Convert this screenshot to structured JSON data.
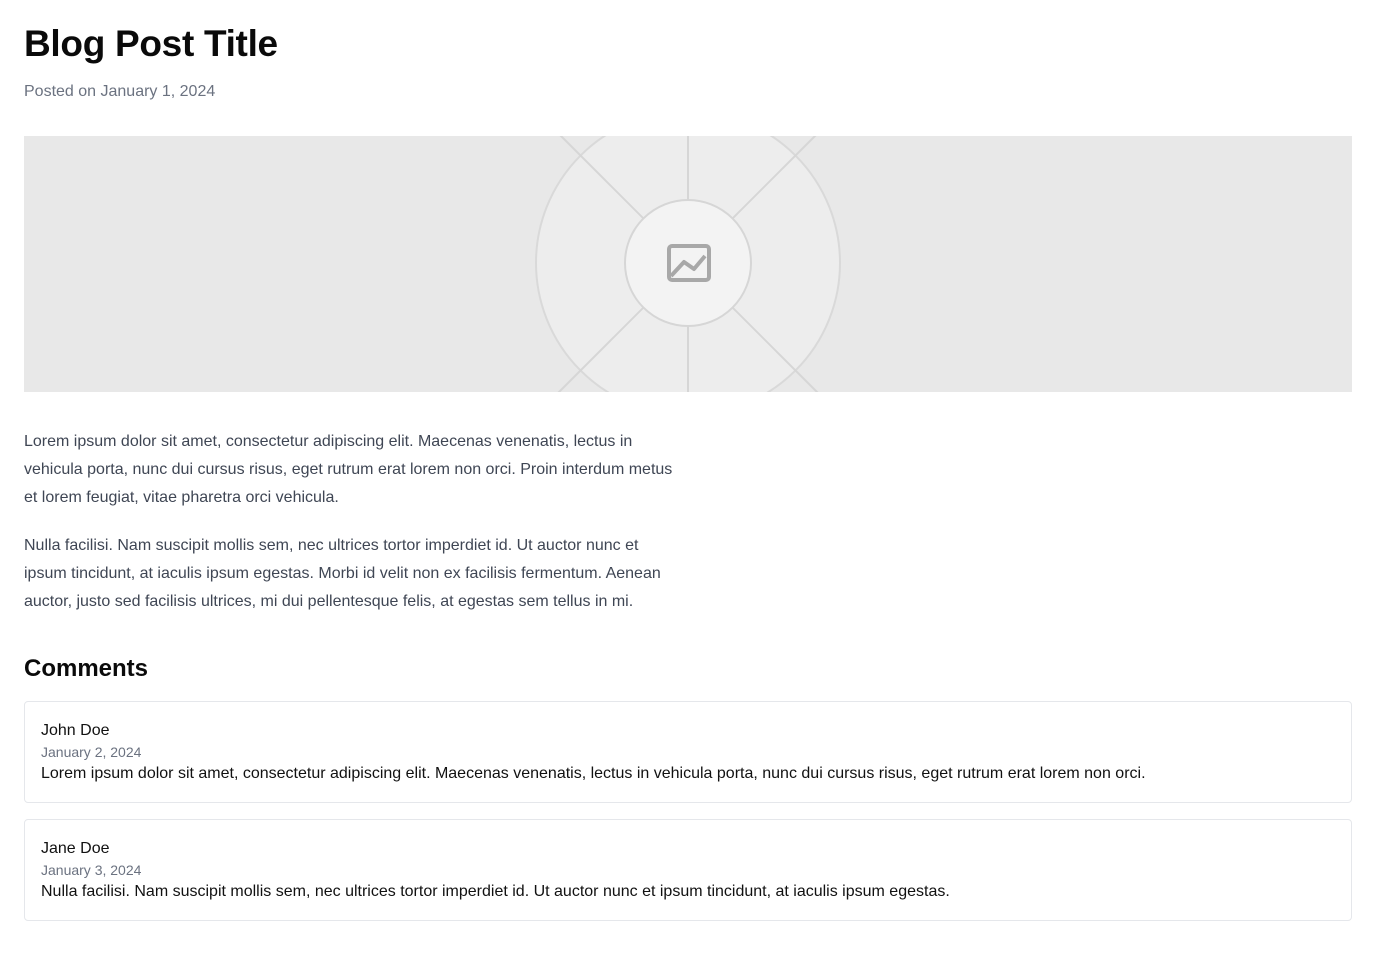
{
  "post": {
    "title": "Blog Post Title",
    "meta": "Posted on January 1, 2024",
    "hero_icon": "image-placeholder-icon",
    "paragraphs": [
      "Lorem ipsum dolor sit amet, consectetur adipiscing elit. Maecenas venenatis, lectus in vehicula porta, nunc dui cursus risus, eget rutrum erat lorem non orci. Proin interdum metus et lorem feugiat, vitae pharetra orci vehicula.",
      "Nulla facilisi. Nam suscipit mollis sem, nec ultrices tortor imperdiet id. Ut auctor nunc et ipsum tincidunt, at iaculis ipsum egestas. Morbi id velit non ex facilisis fermentum. Aenean auctor, justo sed facilisis ultrices, mi dui pellentesque felis, at egestas sem tellus in mi."
    ]
  },
  "comments": {
    "heading": "Comments",
    "items": [
      {
        "author": "John Doe",
        "date": "January 2, 2024",
        "text": "Lorem ipsum dolor sit amet, consectetur adipiscing elit. Maecenas venenatis, lectus in vehicula porta, nunc dui cursus risus, eget rutrum erat lorem non orci."
      },
      {
        "author": "Jane Doe",
        "date": "January 3, 2024",
        "text": "Nulla facilisi. Nam suscipit mollis sem, nec ultrices tortor imperdiet id. Ut auctor nunc et ipsum tincidunt, at iaculis ipsum egestas."
      }
    ]
  },
  "colors": {
    "title": "#0a0a0a",
    "muted": "#6b7280",
    "body_text": "#3f4654",
    "hero_bg": "#e8e8e8",
    "card_border": "#e5e7eb"
  }
}
